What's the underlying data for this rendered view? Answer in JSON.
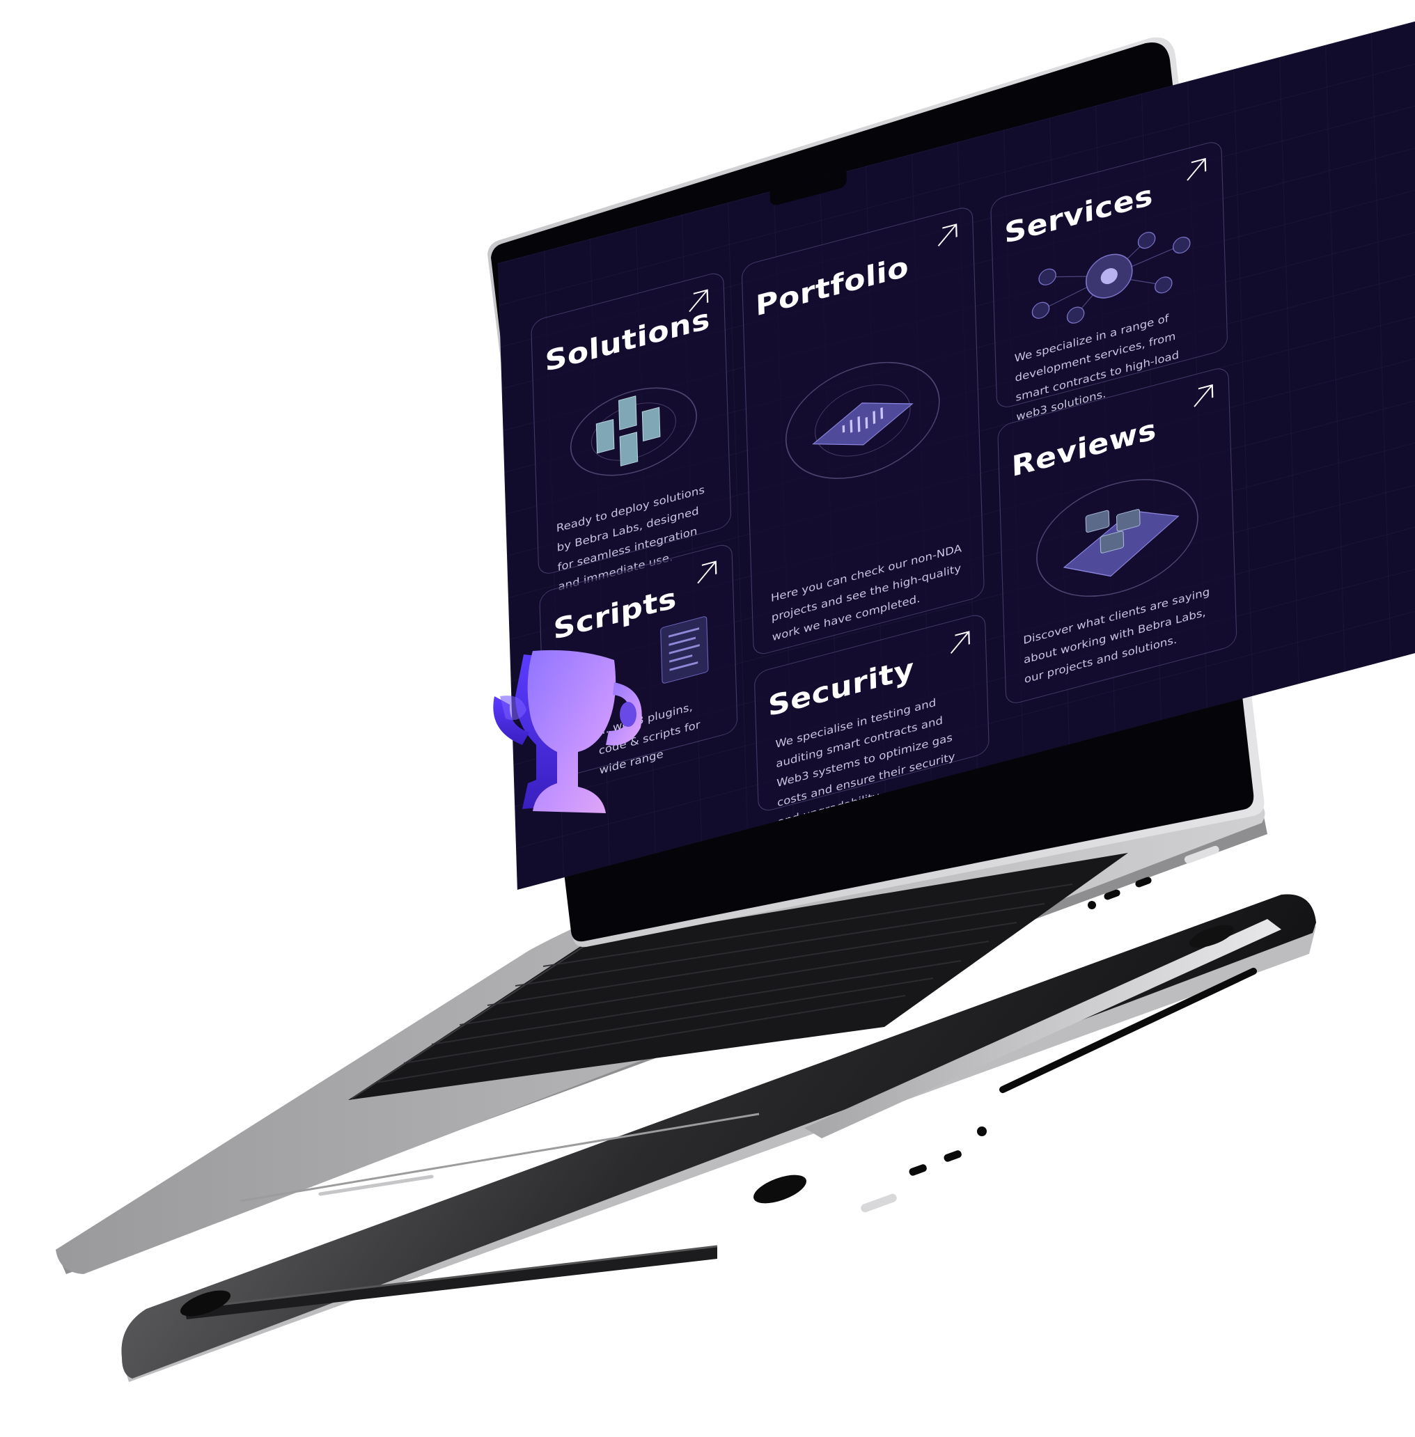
{
  "screen": {
    "cards": {
      "solutions": {
        "title": "Solutions",
        "desc": "Ready to deploy solutions by Bebra Labs, designed for seamless integration and immediate use."
      },
      "portfolio": {
        "title": "Portfolio",
        "desc": "Here you can check our non-NDA projects and see the high-quality work we have completed."
      },
      "services": {
        "title": "Services",
        "desc": "We specialize in a range of development services, from smart contracts to high-load web3 solutions."
      },
      "reviews": {
        "title": "Reviews",
        "desc": "Discover what clients are saying about working with Bebra Labs, our projects and solutions."
      },
      "scripts": {
        "title": "Scripts",
        "desc": "... web3 plugins, code & scripts for wide range"
      },
      "security": {
        "title": "Security",
        "desc": "We specialise in testing and auditing smart contracts and Web3 systems to optimize gas costs and ensure their security and upgradability."
      }
    }
  },
  "icons": {
    "card_arrow": "arrow-up-right-icon",
    "trophy": "trophy-icon"
  },
  "colors": {
    "screen_bg": "#120c2c",
    "accent_purple": "#8b6cff",
    "trophy_light": "#c79bff",
    "trophy_dark": "#4a2fd6",
    "laptop_silver": "#a9a9ab"
  }
}
